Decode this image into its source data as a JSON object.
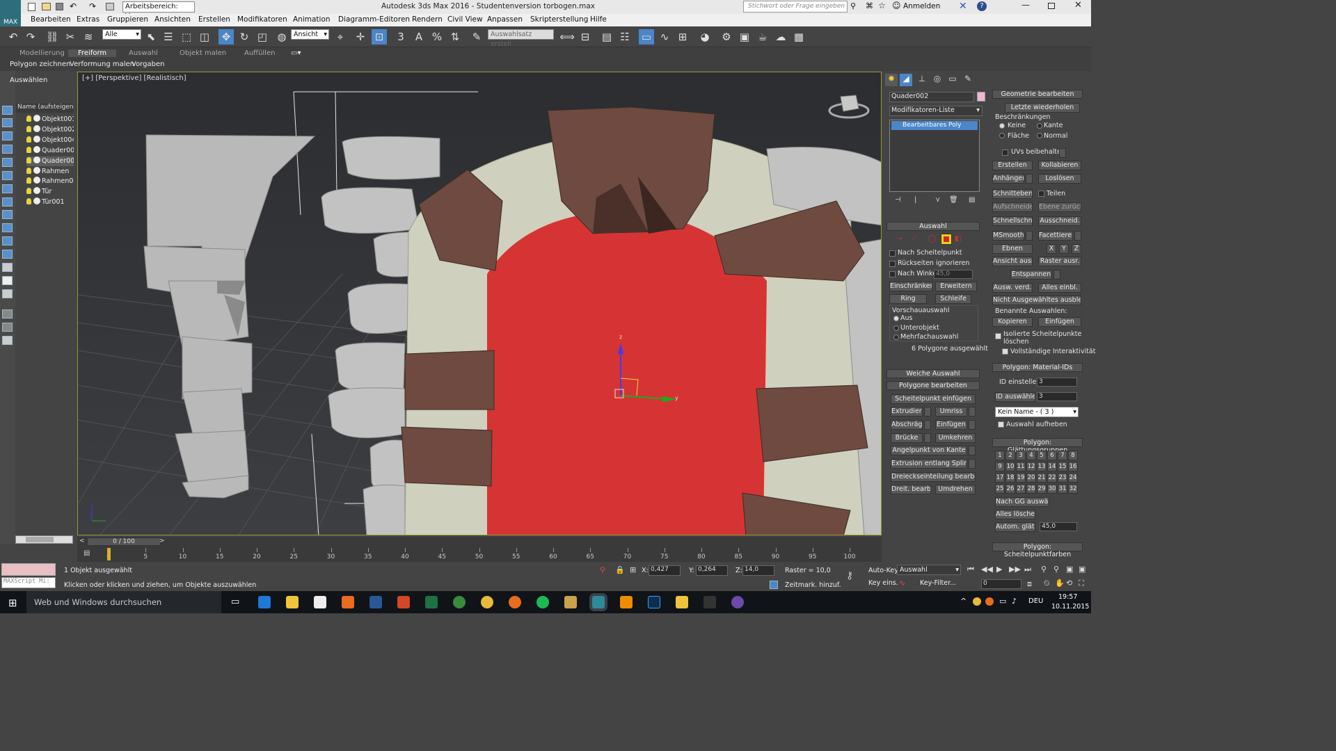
{
  "title_bar": {
    "workspace": "Arbeitsbereich: Vorga",
    "title": "Autodesk 3ds Max 2016  -  Studentenversion    torbogen.max",
    "search_placeholder": "Stichwort oder Frage eingeben",
    "login": "Anmelden"
  },
  "menu": [
    "Bearbeiten",
    "Extras",
    "Gruppieren",
    "Ansichten",
    "Erstellen",
    "Modifikatoren",
    "Animation",
    "Diagramm-Editoren",
    "Rendern",
    "Civil View",
    "Anpassen",
    "Skripterstellung",
    "Hilfe"
  ],
  "toolbar": {
    "filter": "Alle",
    "refcoord": "Ansicht",
    "selset": "Auswahlsatz erstell",
    "snap3": "3",
    "snapa": "A",
    "snapp": "%"
  },
  "ribbon": {
    "tabs": [
      "Modellierung",
      "Freiform",
      "Auswahl",
      "Objekt malen",
      "Auffüllen"
    ],
    "active_tab": "Freiform",
    "subtabs": [
      "Polygon zeichnen",
      "Verformung malen",
      "Vorgaben"
    ]
  },
  "scene_explorer": {
    "title": "Auswählen",
    "header": "Name (aufsteigend s",
    "items": [
      "Objekt001",
      "Objekt002",
      "Objekt004",
      "Quader001",
      "Quader002",
      "Rahmen",
      "Rahmen001",
      "Tür",
      "Tür001"
    ],
    "selected": "Quader002"
  },
  "viewport": {
    "label": "[+] [Perspektive] [Realistisch]",
    "gizmo": {
      "x": "x",
      "y": "y",
      "z": "z"
    }
  },
  "cmdpanel": {
    "object_name": "Quader002",
    "modifier_list": "Modifikatoren-Liste",
    "stack_item": "Bearbeitbares Poly",
    "auswahl": {
      "header": "Auswahl",
      "nach_scheitelpunkt": "Nach Scheitelpunkt",
      "rueckseiten": "Rückseiten ignorieren",
      "nach_winkel": "Nach Winkel:",
      "winkel_value": "45,0",
      "einschraenken": "Einschränken",
      "erweitern": "Erweitern",
      "ring": "Ring",
      "schleife": "Schleife",
      "vorschau": "Vorschauauswahl",
      "aus": "Aus",
      "unterobjekt": "Unterobjekt",
      "mehrfach": "Mehrfachauswahl",
      "status": "6 Polygone ausgewählt"
    },
    "weiche_auswahl": "Weiche Auswahl",
    "polygone_bearbeiten": {
      "header": "Polygone bearbeiten",
      "scheitelpunkt_einfuegen": "Scheitelpunkt einfügen",
      "extrudieren": "Extrudier.",
      "umriss": "Umriss",
      "abschraeg": "Abschräg.",
      "einfuegen": "Einfügen",
      "bruecke": "Brücke",
      "umkehren": "Umkehren",
      "angelpunkt": "Angelpunkt von Kante",
      "extrusion_spline": "Extrusion entlang Spline",
      "dreieck": "Dreieckseinteilung bearbeiten",
      "dreit": "Dreit. bearb.",
      "umdrehen": "Umdrehen"
    }
  },
  "geometry": {
    "header": "Geometrie bearbeiten",
    "letzte": "Letzte wiederholen",
    "beschraenkungen": "Beschränkungen",
    "keine": "Keine",
    "kante": "Kante",
    "flaeche": "Fläche",
    "normal": "Normal",
    "uvs": "UVs beibehalten",
    "erstellen": "Erstellen",
    "kollabieren": "Kollabieren",
    "anhaengen": "Anhängen",
    "loesen": "Loslösen",
    "schnittebene": "Schnittebene",
    "teilen": "Teilen",
    "aufschneiden": "Aufschneiden",
    "ebene_zurueck": "Ebene zurück",
    "schnellschnitt": "Schnellschnitt",
    "ausschneid": "Ausschneid.",
    "msmooth": "MSmooth",
    "facettieren": "Facettieren",
    "ebnen": "Ebnen",
    "x": "X",
    "y": "Y",
    "z": "Z",
    "ansicht_ausr": "Ansicht ausr.",
    "raster_ausr": "Raster ausr.",
    "entspannen": "Entspannen",
    "ausw_verd": "Ausw. verd.",
    "alles_einbl": "Alles einbl.",
    "nicht_ausgewaehlte": "Nicht Ausgewähltes ausblenden",
    "benannte": "Benannte Auswahlen:",
    "kopieren": "Kopieren",
    "einfuegen": "Einfügen",
    "isolierte": "Isolierte Scheitelpunkte löschen",
    "vollstaendige": "Vollständige Interaktivität"
  },
  "material_ids": {
    "header": "Polygon: Material-IDs",
    "id_einstellen": "ID einstellen:",
    "id_einstellen_val": "3",
    "id_auswaehlen": "ID auswählen",
    "id_auswaehlen_val": "3",
    "name_dropdown": "Kein Name - ( 3 )",
    "auswahl_aufheben": "Auswahl aufheben"
  },
  "smoothing": {
    "header": "Polygon: Glättungsgruppen",
    "numbers": [
      "1",
      "2",
      "3",
      "4",
      "5",
      "6",
      "7",
      "8",
      "9",
      "10",
      "11",
      "12",
      "13",
      "14",
      "15",
      "16",
      "17",
      "18",
      "19",
      "20",
      "21",
      "22",
      "23",
      "24",
      "25",
      "26",
      "27",
      "28",
      "29",
      "30",
      "31",
      "32"
    ],
    "nach_gg": "Nach GG auswählen",
    "alles_loeschen": "Alles löschen",
    "autom": "Autom. glätten",
    "autom_val": "45,0",
    "scheitelpunktfarben": "Polygon: Scheitelpunktfarben"
  },
  "timeline": {
    "frame": "0 / 100",
    "ticks": [
      "0",
      "5",
      "10",
      "15",
      "20",
      "25",
      "30",
      "35",
      "40",
      "45",
      "50",
      "55",
      "60",
      "65",
      "70",
      "75",
      "80",
      "85",
      "90",
      "95",
      "100"
    ]
  },
  "status": {
    "maxscript": "MAXScript Mi:",
    "selected": "1 Objekt ausgewählt",
    "prompt": "Klicken oder klicken und ziehen, um Objekte auszuwählen",
    "x_label": "X:",
    "x_val": "0,427",
    "y_label": "Y:",
    "y_val": "0,264",
    "z_label": "Z:",
    "z_val": "14,0",
    "raster": "Raster = 10,0",
    "zeitmark": "Zeitmark. hinzuf.",
    "autokey": "Auto-Key",
    "auswahl": "Auswahl",
    "keyeins": "Key eins.",
    "keyfilter": "Key-Filter...",
    "frame_val": "0"
  },
  "taskbar": {
    "search": "Web und Windows durchsuchen",
    "lang": "DEU",
    "time": "19:57",
    "date": "10.11.2015"
  },
  "colors": {
    "poly_red": "#d63434",
    "stone_brown": "#6e4a40",
    "wall_gray": "#b8b8b8",
    "mortar": "#cfd0bd",
    "accent_blue": "#5b8fc9"
  }
}
